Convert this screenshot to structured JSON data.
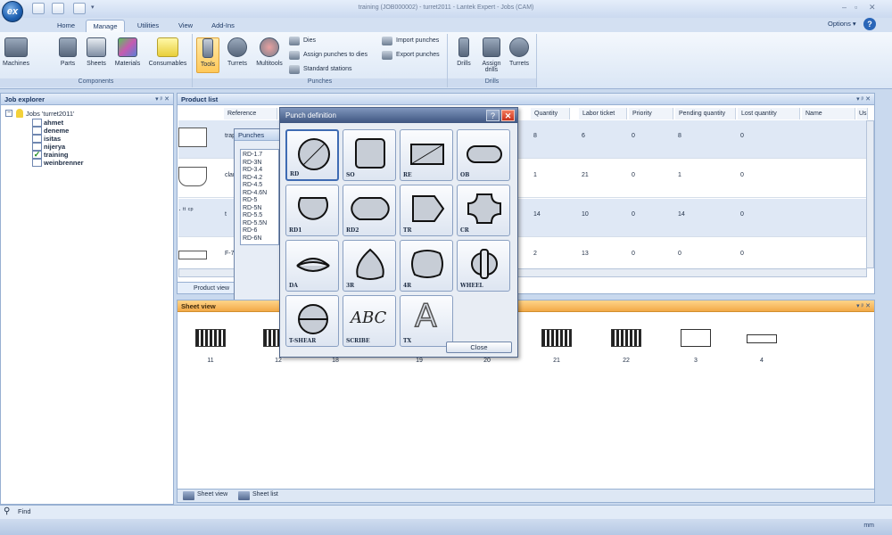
{
  "window": {
    "title": "training (JOB000002) - turret2011 - Lantek Expert - Jobs (CAM)",
    "minimize": "–",
    "restore": "▫",
    "close": "✕"
  },
  "app": {
    "orb_label": "ex"
  },
  "ribbon_tabs": [
    "Home",
    "Manage",
    "Utilities",
    "View",
    "Add-Ins"
  ],
  "active_tab": "Manage",
  "options": {
    "label": "Options ▾",
    "help": "?"
  },
  "ribbon": {
    "components": {
      "label": "Components",
      "buttons": [
        "Machines",
        "Parts",
        "Sheets",
        "Materials",
        "Consumables"
      ]
    },
    "punches": {
      "label": "Punches",
      "buttons": [
        "Tools",
        "Turrets",
        "Multitools"
      ],
      "small": [
        "Dies",
        "Assign punches to dies",
        "Standard stations",
        "Import punches",
        "Export punches"
      ]
    },
    "drills": {
      "label": "Drills",
      "buttons": [
        "Drills",
        "Assign drills",
        "Turrets"
      ]
    }
  },
  "job_explorer": {
    "title": "Job explorer",
    "controls": "▾ ᵖ ✕",
    "root": "Jobs 'turret2011'",
    "jobs": [
      "ahmet",
      "deneme",
      "isitas",
      "nijerya",
      "training",
      "weinbrenner"
    ],
    "checked_job": "training"
  },
  "product_list": {
    "title": "Product list",
    "controls": "▾ ᵖ ✕",
    "columns": [
      "Reference",
      "Quantity",
      "Labor ticket",
      "Priority",
      "Pending quantity",
      "Lost quantity",
      "Name",
      "Us"
    ],
    "rows": [
      {
        "reference": "trap",
        "quantity": "8",
        "labor_ticket": "6",
        "priority": "0",
        "pending": "8",
        "lost": "0"
      },
      {
        "reference": "clar",
        "quantity": "1",
        "labor_ticket": "21",
        "priority": "0",
        "pending": "1",
        "lost": "0"
      },
      {
        "reference": "t",
        "quantity": "14",
        "labor_ticket": "10",
        "priority": "0",
        "pending": "14",
        "lost": "0"
      },
      {
        "reference": "F-7",
        "quantity": "2",
        "labor_ticket": "13",
        "priority": "0",
        "pending": "0",
        "lost": "0"
      }
    ],
    "tab_label": "Product view"
  },
  "punches_panel": {
    "title": "Punches",
    "items": [
      "RD-1.7",
      "RD-3N",
      "RD-3.4",
      "RD-4.2",
      "RD-4.5",
      "RD-4.6N",
      "RD-5",
      "RD-5N",
      "RD-5.5",
      "RD-5.5N",
      "RD-6",
      "RD-6N"
    ]
  },
  "punch_dialog": {
    "title": "Punch definition",
    "help": "?",
    "close_x": "✕",
    "shapes": [
      "RD",
      "SO",
      "RE",
      "OB",
      "RD1",
      "RD2",
      "TR",
      "CR",
      "DA",
      "3R",
      "4R",
      "WHEEL",
      "T-SHEAR",
      "SCRIBE",
      "TX"
    ],
    "selected": "RD",
    "scribe_text": "ABC",
    "tx_text": "A",
    "close_button": "Close"
  },
  "sheet_view": {
    "title": "Sheet view",
    "controls": "▾ ᵖ ✕",
    "sheets": [
      "11",
      "12",
      "18",
      "19",
      "20",
      "21",
      "22",
      "3",
      "4"
    ]
  },
  "bottom_tabs": [
    "Sheet view",
    "Sheet list"
  ],
  "find": {
    "label": "Find"
  },
  "status": {
    "units": "mm"
  }
}
